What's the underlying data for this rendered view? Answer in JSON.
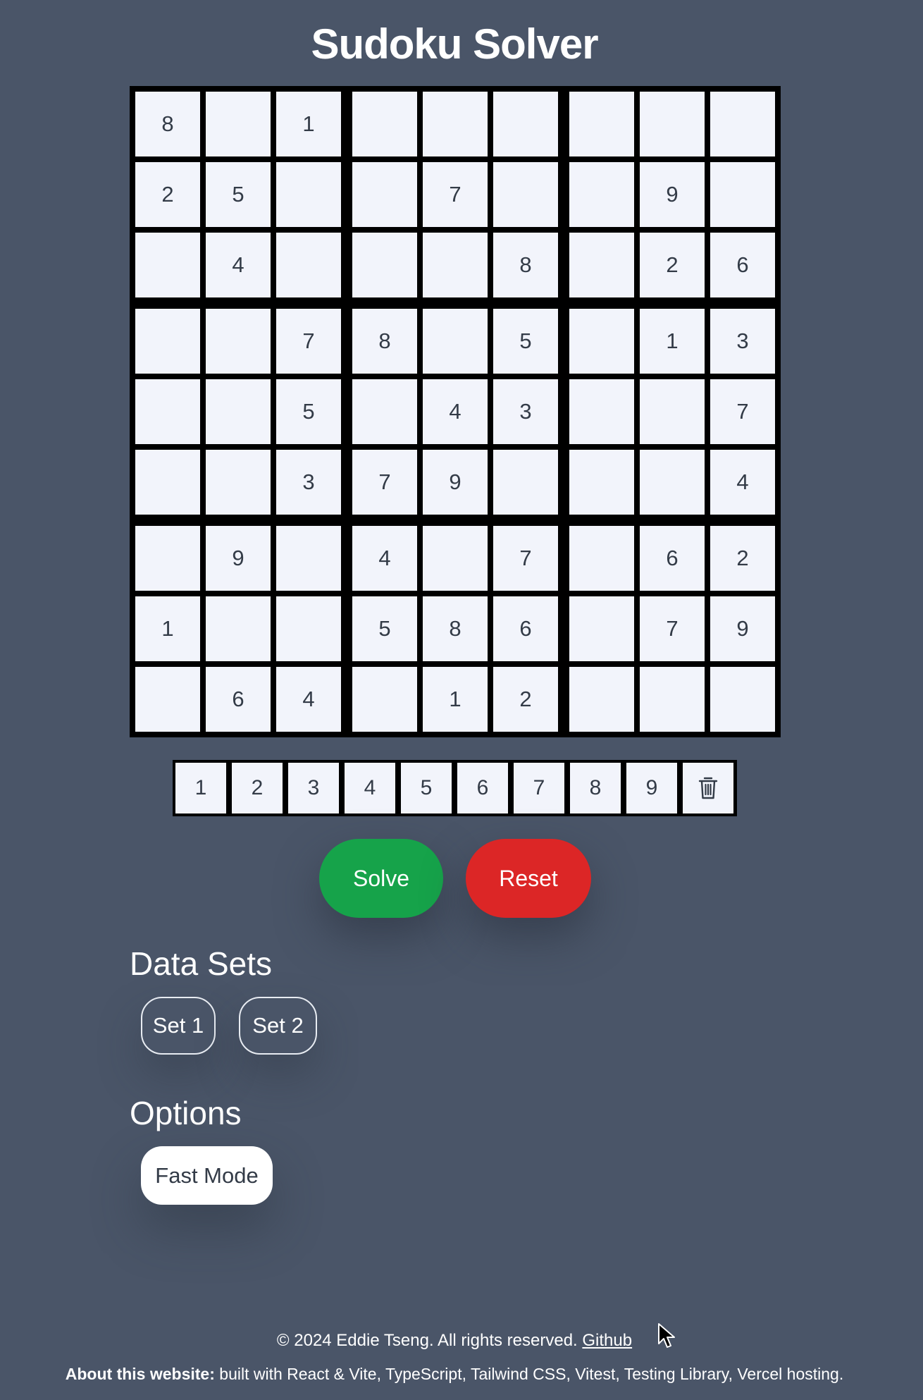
{
  "page": {
    "title": "Sudoku Solver"
  },
  "board": [
    [
      "8",
      "",
      "1",
      "",
      "",
      "",
      "",
      "",
      ""
    ],
    [
      "2",
      "5",
      "",
      "",
      "7",
      "",
      "",
      "9",
      ""
    ],
    [
      "",
      "4",
      "",
      "",
      "",
      "8",
      "",
      "2",
      "6"
    ],
    [
      "",
      "",
      "7",
      "8",
      "",
      "5",
      "",
      "1",
      "3"
    ],
    [
      "",
      "",
      "5",
      "",
      "4",
      "3",
      "",
      "",
      "7"
    ],
    [
      "",
      "",
      "3",
      "7",
      "9",
      "",
      "",
      "",
      "4"
    ],
    [
      "",
      "9",
      "",
      "4",
      "",
      "7",
      "",
      "6",
      "2"
    ],
    [
      "1",
      "",
      "",
      "5",
      "8",
      "6",
      "",
      "7",
      "9"
    ],
    [
      "",
      "6",
      "4",
      "",
      "1",
      "2",
      "",
      "",
      ""
    ]
  ],
  "number_pad": {
    "digits": [
      "1",
      "2",
      "3",
      "4",
      "5",
      "6",
      "7",
      "8",
      "9"
    ],
    "clear_icon": "trash-icon"
  },
  "actions": {
    "solve_label": "Solve",
    "reset_label": "Reset",
    "solve_color": "#16a34a",
    "reset_color": "#dc2626"
  },
  "data_sets": {
    "heading": "Data Sets",
    "items": [
      "Set 1",
      "Set 2"
    ]
  },
  "options": {
    "heading": "Options",
    "fast_mode_label": "Fast Mode"
  },
  "footer": {
    "copyright": "© 2024 Eddie Tseng. All rights reserved.",
    "github_label": "Github",
    "about_label": "About this website:",
    "about_text": "built with React & Vite, TypeScript, Tailwind CSS, Vitest, Testing Library, Vercel hosting."
  },
  "theme": {
    "background": "#4a5568",
    "cell_background": "#f2f4fb",
    "grid_line": "#000000"
  }
}
